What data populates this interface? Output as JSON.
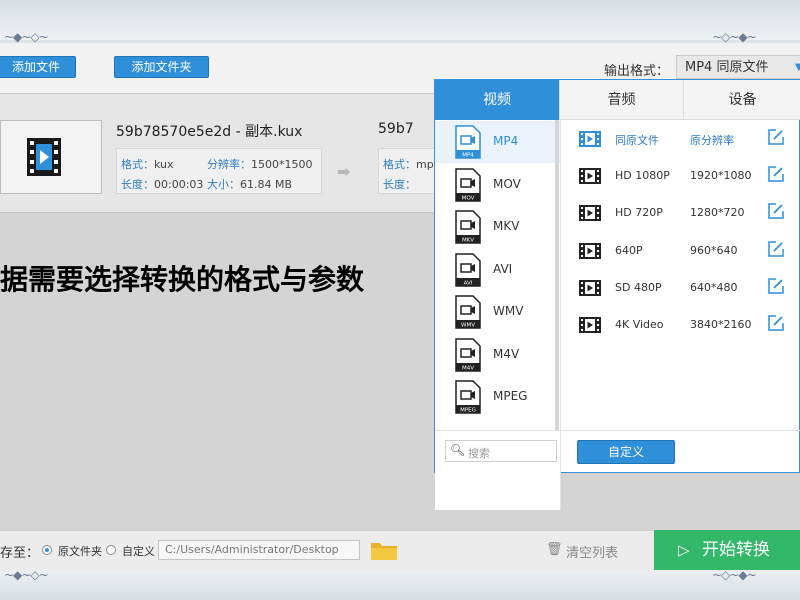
{
  "toolbar": {
    "add_file": "添加文件",
    "add_folder": "添加文件夹",
    "output_format_label": "输出格式：",
    "output_format_value": "MP4  同原文件"
  },
  "file_item": {
    "name": "59b78570e5e2d - 副本.kux",
    "format_key": "格式：",
    "format_val": "kux",
    "resolution_key": "分辨率：",
    "resolution_val": "1500*1500",
    "duration_key": "长度：",
    "duration_val": "00:00:03",
    "size_key": "大小：",
    "size_val": "61.84 MB",
    "output_name": "59b7",
    "output_format_key": "格式：",
    "output_format_val": "mp",
    "output_duration_key": "长度："
  },
  "caption": "据需要选择转换的格式与参数",
  "popup": {
    "tabs": [
      "视频",
      "音频",
      "设备"
    ],
    "formats": [
      {
        "label": "MP4",
        "selected": true,
        "tag": "MP4"
      },
      {
        "label": "MOV",
        "selected": false,
        "tag": "MOV"
      },
      {
        "label": "MKV",
        "selected": false,
        "tag": "MKV"
      },
      {
        "label": "AVI",
        "selected": false,
        "tag": "AVI"
      },
      {
        "label": "WMV",
        "selected": false,
        "tag": "WMV"
      },
      {
        "label": "M4V",
        "selected": false,
        "tag": "M4V"
      },
      {
        "label": "MPEG",
        "selected": false,
        "tag": "MPEG"
      }
    ],
    "presets": [
      {
        "name": "同原文件",
        "value": "原分辨率",
        "highlight": true
      },
      {
        "name": "HD 1080P",
        "value": "1920*1080",
        "highlight": false
      },
      {
        "name": "HD 720P",
        "value": "1280*720",
        "highlight": false
      },
      {
        "name": "640P",
        "value": "960*640",
        "highlight": false
      },
      {
        "name": "SD 480P",
        "value": "640*480",
        "highlight": false
      },
      {
        "name": "4K Video",
        "value": "3840*2160",
        "highlight": false
      }
    ],
    "search_placeholder": "搜索",
    "custom_button": "自定义"
  },
  "bottom": {
    "save_to": "存至：",
    "radio_original": "原文件夹",
    "radio_custom": "自定义",
    "path": "C:/Users/Administrator/Desktop",
    "clear_list": "清空列表",
    "start": "开始转换"
  },
  "colors": {
    "accent": "#2f8fd8",
    "start": "#33b86a"
  }
}
